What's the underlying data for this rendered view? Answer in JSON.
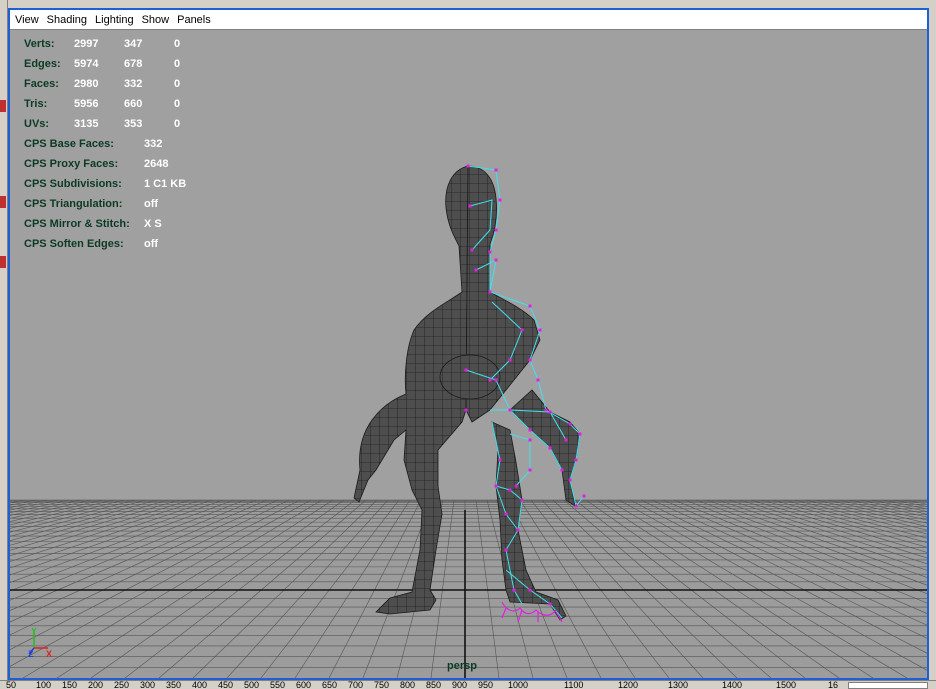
{
  "menu": [
    "View",
    "Shading",
    "Lighting",
    "Show",
    "Panels"
  ],
  "hud": {
    "stats": [
      {
        "label": "Verts:",
        "v1": "2997",
        "v2": "347",
        "v3": "0"
      },
      {
        "label": "Edges:",
        "v1": "5974",
        "v2": "678",
        "v3": "0"
      },
      {
        "label": "Faces:",
        "v1": "2980",
        "v2": "332",
        "v3": "0"
      },
      {
        "label": "Tris:",
        "v1": "5956",
        "v2": "660",
        "v3": "0"
      },
      {
        "label": "UVs:",
        "v1": "3135",
        "v2": "353",
        "v3": "0"
      }
    ],
    "cps": [
      {
        "label": "CPS Base Faces:",
        "value": "332"
      },
      {
        "label": "CPS Proxy Faces:",
        "value": "2648"
      },
      {
        "label": "CPS Subdivisions:",
        "value": "1 C1 KB"
      },
      {
        "label": "CPS Triangulation:",
        "value": "off"
      },
      {
        "label": "CPS Mirror & Stitch:",
        "value": "X S"
      },
      {
        "label": "CPS Soften Edges:",
        "value": "off"
      }
    ]
  },
  "camera_label": "persp",
  "axis": {
    "y": "Y",
    "z": "Z",
    "x": "X"
  },
  "ruler": [
    "50",
    "100",
    "150",
    "200",
    "250",
    "300",
    "350",
    "400",
    "450",
    "500",
    "550",
    "600",
    "650",
    "700",
    "750",
    "800",
    "850",
    "900",
    "950",
    "1000",
    "1100",
    "1200",
    "1300",
    "1400",
    "1500",
    "16"
  ],
  "colors": {
    "frame": "#1f5fd6",
    "viewport_bg": "#a0a0a0",
    "hud_label": "#0c3a24",
    "cage": "#40e0f0",
    "vertex": "#e020e0"
  }
}
